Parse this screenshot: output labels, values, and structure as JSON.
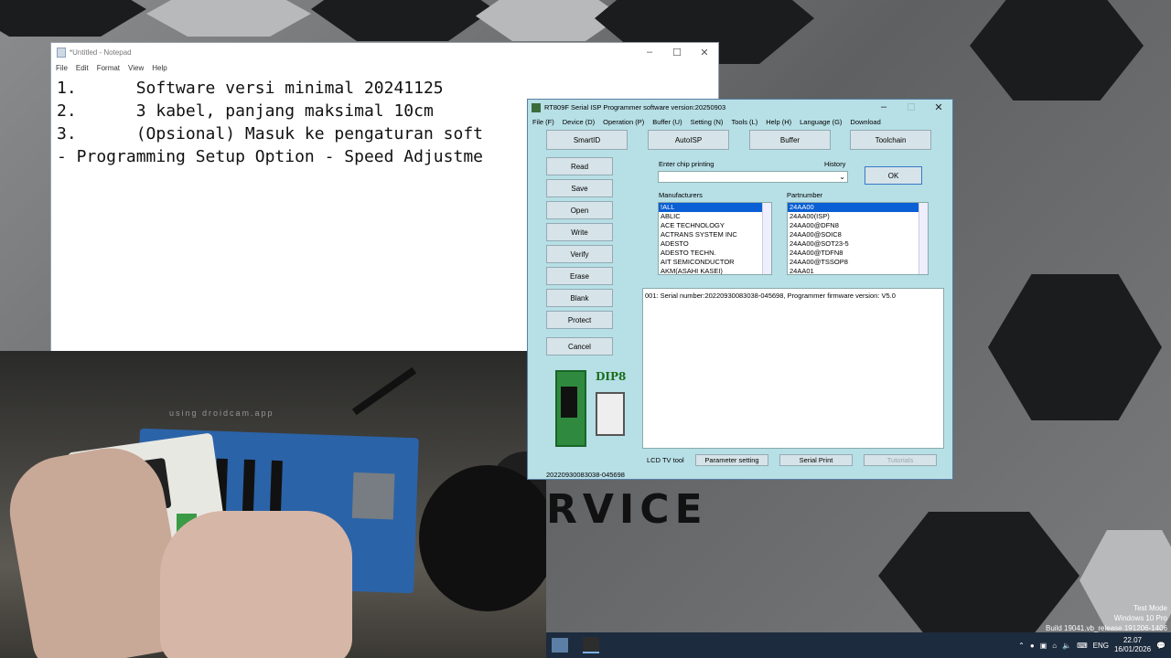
{
  "notepad": {
    "title": "*Untitled - Notepad",
    "menu": [
      "File",
      "Edit",
      "Format",
      "View",
      "Help"
    ],
    "lines": [
      "1.      Software versi minimal 20241125",
      "2.      3 kabel, panjang maksimal 10cm",
      "3.      (Opsional) Masuk ke pengaturan soft",
      "- Programming Setup Option - Speed Adjustme"
    ]
  },
  "camera": {
    "watermark": "using droidcam.app"
  },
  "rt": {
    "title": "RT809F Serial ISP Programmer software version:20250903",
    "menu": [
      "File (F)",
      "Device (D)",
      "Operation (P)",
      "Buffer (U)",
      "Setting (N)",
      "Tools (L)",
      "Help (H)",
      "Language (G)",
      "Download"
    ],
    "top_buttons": [
      "SmartID",
      "AutoISP",
      "Buffer",
      "Toolchain"
    ],
    "side_buttons": [
      "Read",
      "Save",
      "Open",
      "Write",
      "Verify",
      "Erase",
      "Blank",
      "Protect",
      "Cancel"
    ],
    "chip_label": "Enter chip printing",
    "history_label": "History",
    "ok": "OK",
    "manufacturers_label": "Manufacturers",
    "partnumber_label": "Partnumber",
    "manufacturers": [
      "!ALL",
      "ABLIC",
      "ACE TECHNOLOGY",
      "ACTRANS SYSTEM INC",
      "ADESTO",
      "ADESTO TECHN.",
      "AIT SEMICONDUCTOR",
      "AKM(ASAHI KASEI)"
    ],
    "partnumbers": [
      "24AA00",
      "24AA00(ISP)",
      "24AA00@DFN8",
      "24AA00@SOIC8",
      "24AA00@SOT23-5",
      "24AA00@TDFN8",
      "24AA00@TSSOP8",
      "24AA01"
    ],
    "log": "001:  Serial number:20220930083038-045698, Programmer firmware version: V5.0",
    "dip_label": "DIP8",
    "bottom": {
      "lcd": "LCD TV tool",
      "param": "Parameter setting",
      "serial": "Serial Print",
      "tutorials": "Tutorials"
    },
    "status": "20220930083038-045698"
  },
  "service_text": "RVICE",
  "os_watermark": [
    "Test Mode",
    "Windows 10 Pro",
    "Build 19041.vb_release.191206-1406"
  ],
  "taskbar": {
    "lang": "ENG",
    "time": "22.07",
    "date": "16/01/2026",
    "notif_count": "3"
  }
}
